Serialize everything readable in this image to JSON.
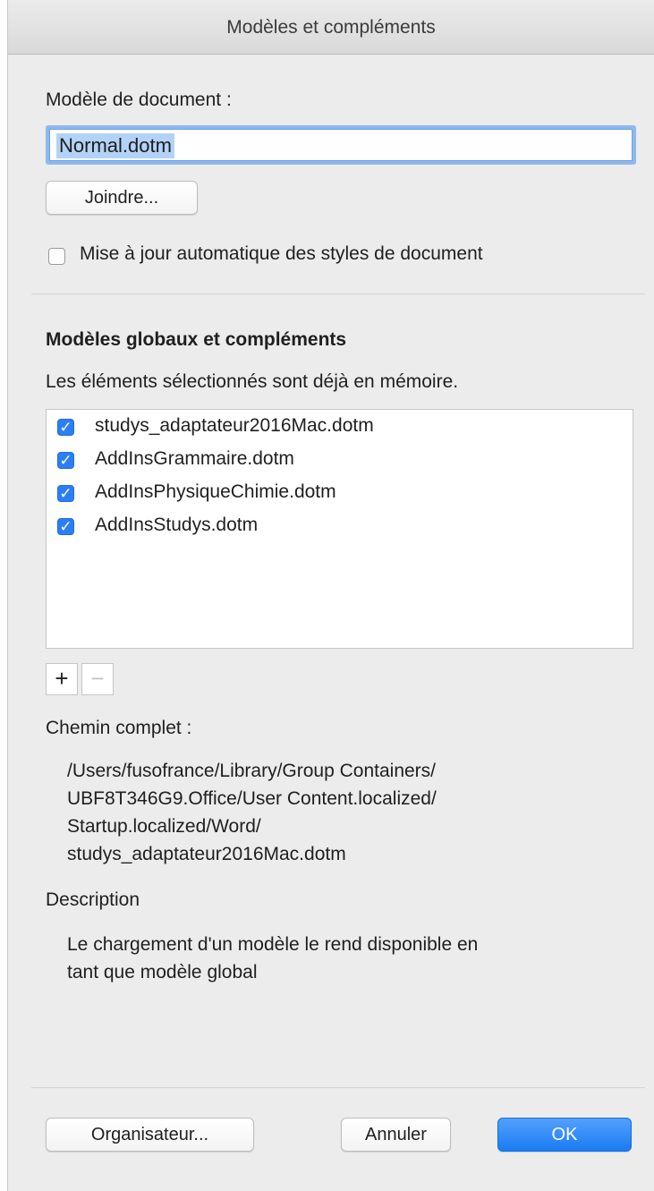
{
  "window": {
    "title": "Modèles et compléments"
  },
  "document_template": {
    "label": "Modèle de document :",
    "value": "Normal.dotm",
    "attach_button": "Joindre..."
  },
  "auto_update": {
    "label": "Mise à jour automatique des styles de document",
    "checked": false
  },
  "global": {
    "heading": "Modèles globaux et compléments",
    "note": "Les éléments sélectionnés sont déjà en mémoire.",
    "items": [
      {
        "label": "studys_adaptateur2016Mac.dotm",
        "checked": true
      },
      {
        "label": "AddInsGrammaire.dotm",
        "checked": true
      },
      {
        "label": "AddInsPhysiqueChimie.dotm",
        "checked": true
      },
      {
        "label": "AddInsStudys.dotm",
        "checked": true
      }
    ],
    "add_symbol": "+",
    "remove_symbol": "−"
  },
  "full_path": {
    "label": "Chemin complet :",
    "lines": [
      "/Users/fusofrance/Library/Group Containers/",
      "UBF8T346G9.Office/User Content.localized/",
      "Startup.localized/Word/",
      "studys_adaptateur2016Mac.dotm"
    ]
  },
  "description": {
    "label": "Description",
    "lines": [
      "Le chargement d'un modèle le rend disponible en",
      "tant que modèle global"
    ]
  },
  "buttons": {
    "organizer": "Organisateur...",
    "cancel": "Annuler",
    "ok": "OK"
  },
  "check_glyph": "✓",
  "colors": {
    "accent": "#2b7ef5",
    "selection": "#b3d2f7",
    "window_bg": "#ececec"
  }
}
